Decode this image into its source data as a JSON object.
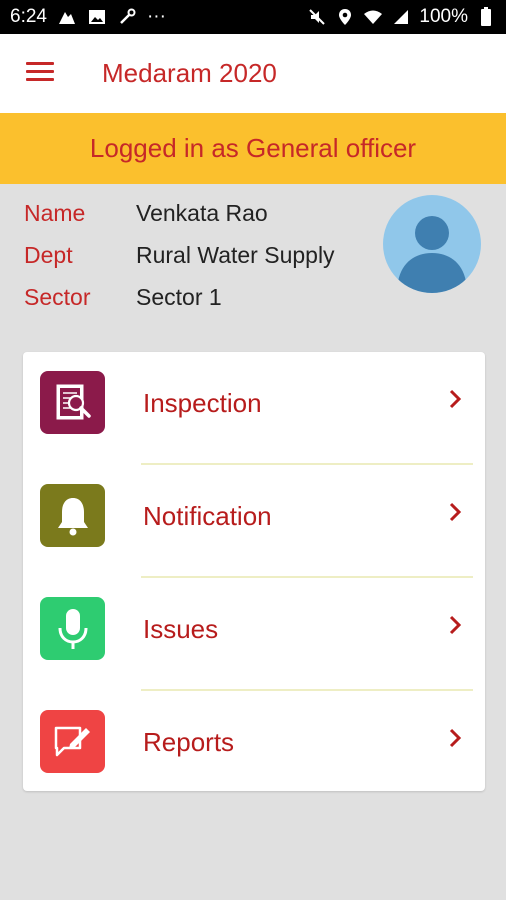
{
  "status_bar": {
    "time": "6:24",
    "dots": "···",
    "battery_text": "100%"
  },
  "app": {
    "title": "Medaram 2020"
  },
  "banner": {
    "text": "Logged in as General officer"
  },
  "profile": {
    "name_label": "Name",
    "name_value": "Venkata Rao",
    "dept_label": "Dept",
    "dept_value": "Rural Water Supply",
    "sector_label": "Sector",
    "sector_value": "Sector 1"
  },
  "menu": {
    "items": [
      {
        "label": "Inspection",
        "icon": "inspection-icon",
        "color": "#8b1a4a"
      },
      {
        "label": "Notification",
        "icon": "bell-icon",
        "color": "#7b7a1c"
      },
      {
        "label": "Issues",
        "icon": "microphone-icon",
        "color": "#2ecc71"
      },
      {
        "label": "Reports",
        "icon": "report-edit-icon",
        "color": "#ef4444"
      }
    ]
  },
  "colors": {
    "accent": "#c62828",
    "banner": "#fbc02d",
    "background": "#e0e0e0"
  }
}
